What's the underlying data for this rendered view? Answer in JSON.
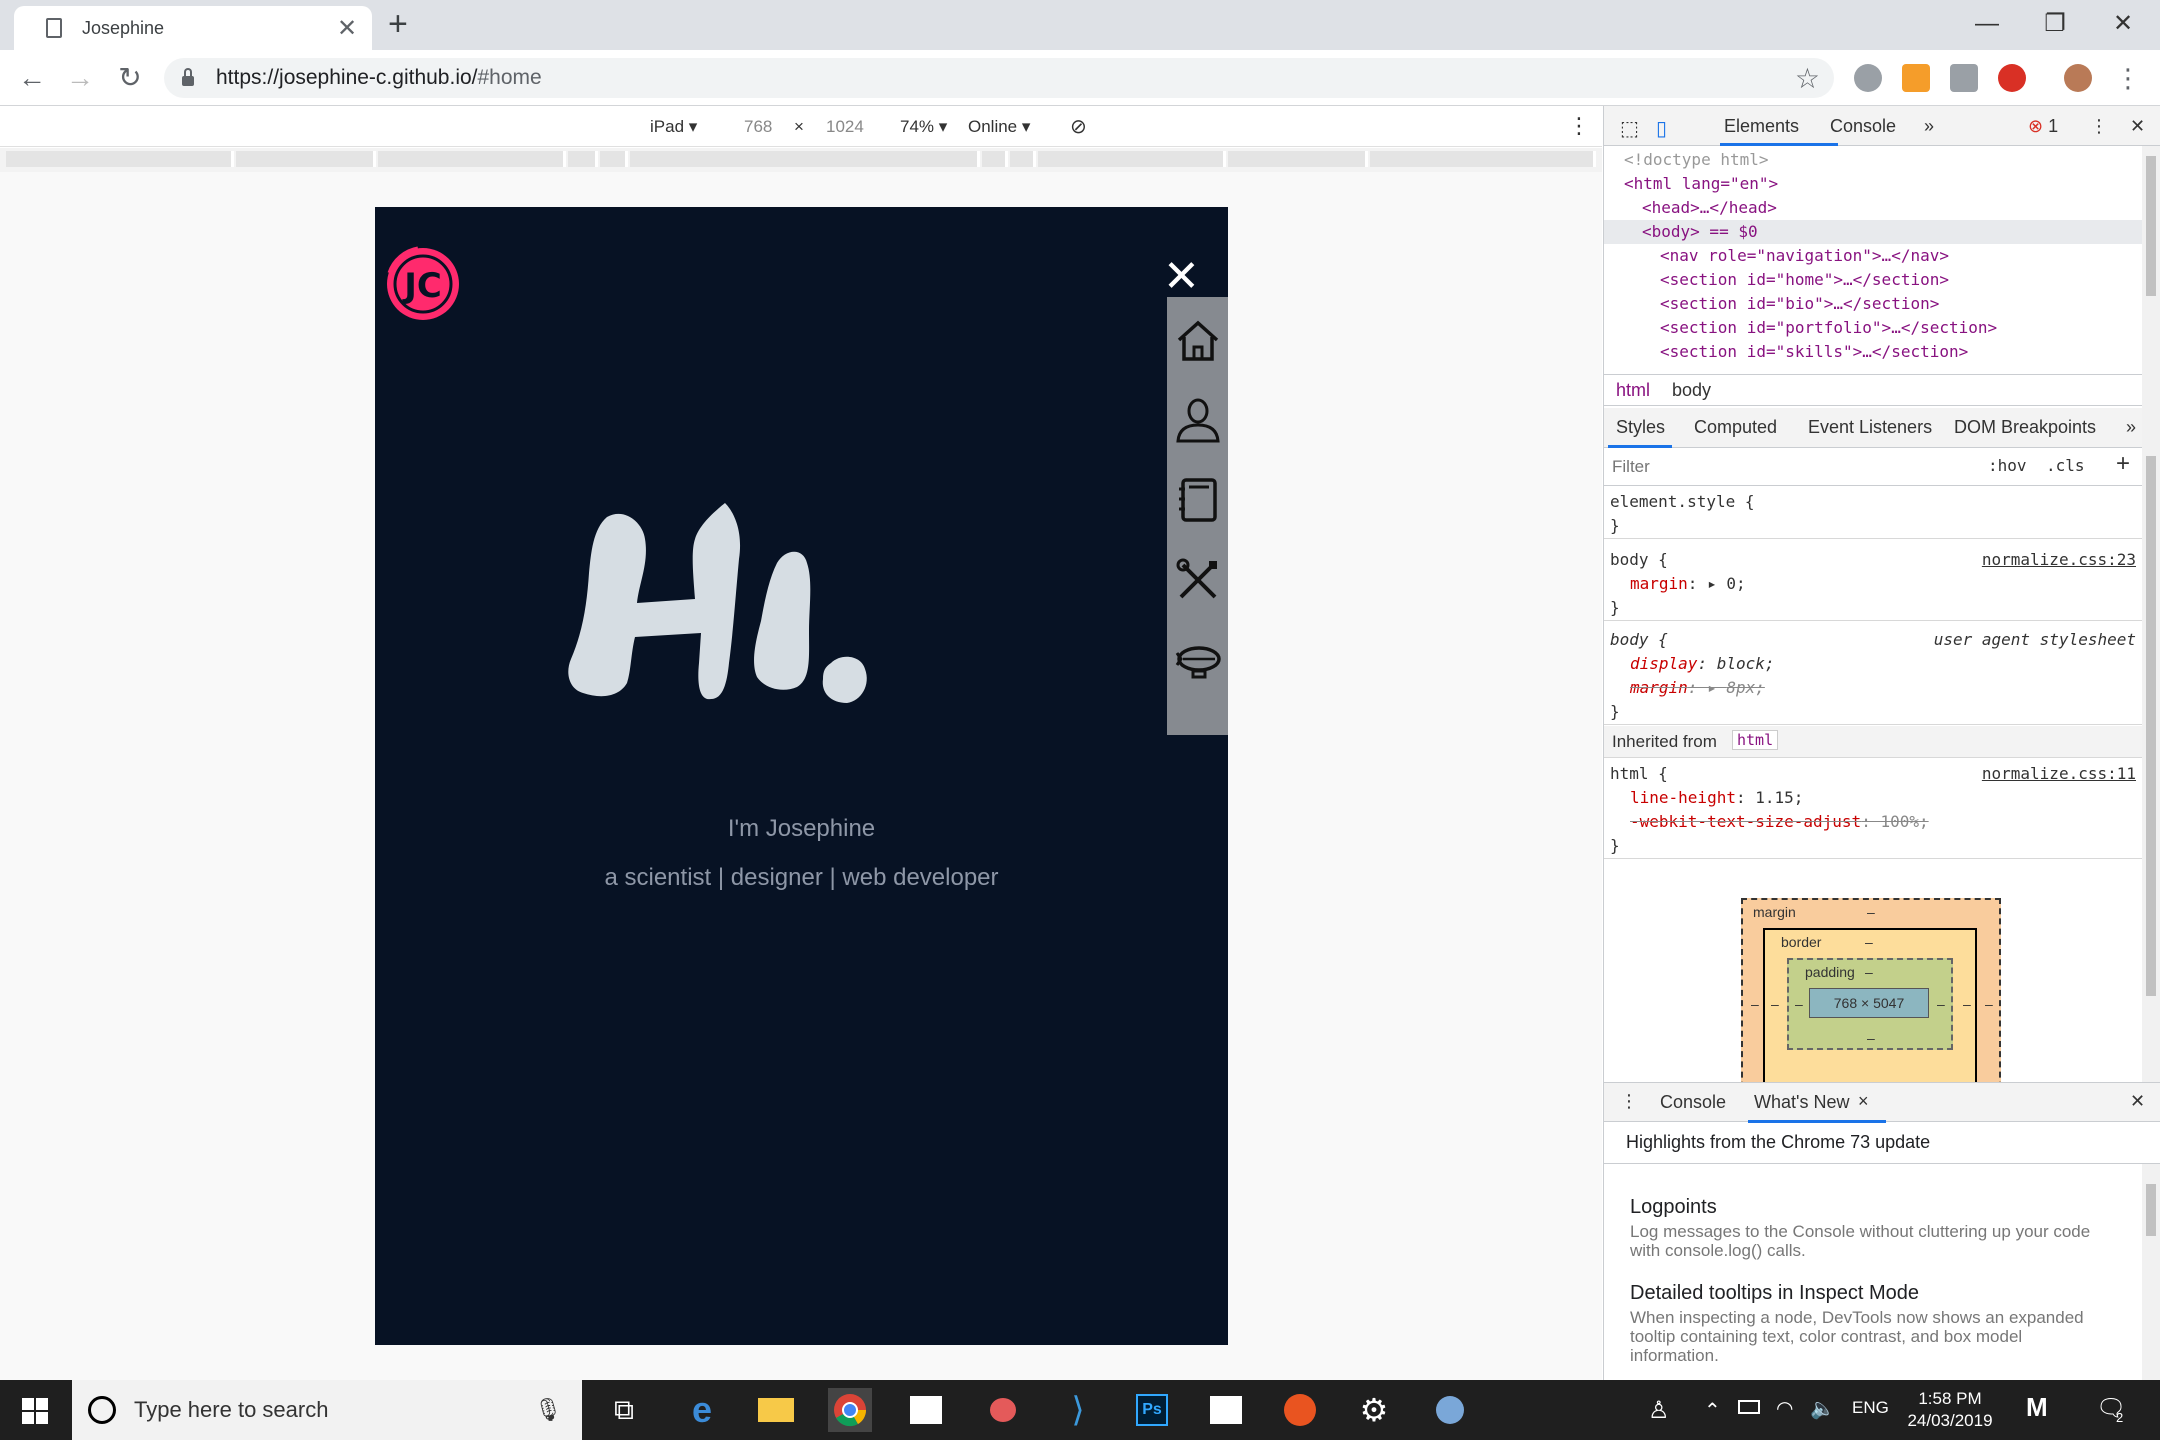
{
  "browser": {
    "tab_title": "Josephine",
    "tab_close": "✕",
    "new_tab": "+",
    "window_controls": {
      "minimize": "—",
      "restore": "❐",
      "close": "✕"
    },
    "url_host": "https://josephine-c.github.io/",
    "url_path": "#home"
  },
  "device_toolbar": {
    "device": "iPad",
    "width": "768",
    "times": "×",
    "height": "1024",
    "zoom": "74%",
    "network": "Online"
  },
  "page": {
    "logo_text": "JC",
    "intro_name": "I'm Josephine",
    "intro_roles": "a scientist | designer | web developer",
    "nav_icons": [
      "home-icon",
      "person-icon",
      "notebook-icon",
      "tools-icon",
      "blimp-icon"
    ],
    "colors": {
      "background": "#071224",
      "accent": "#ff2a6d",
      "hi_text": "#d6dde3",
      "sidenav": "#868a90"
    }
  },
  "devtools": {
    "tabs": {
      "elements": "Elements",
      "console": "Console",
      "more": "»"
    },
    "error_count": "1",
    "dom": [
      {
        "text": "<!doctype html>"
      },
      {
        "text": "<html lang=\"en\">"
      },
      {
        "text": "<head>…</head>"
      },
      {
        "text": "<body> == $0"
      },
      {
        "text": "<nav role=\"navigation\">…</nav>"
      },
      {
        "text": "<section id=\"home\">…</section>"
      },
      {
        "text": "<section id=\"bio\">…</section>"
      },
      {
        "text": "<section id=\"portfolio\">…</section>"
      },
      {
        "text": "<section id=\"skills\">…</section>"
      }
    ],
    "breadcrumbs": [
      "html",
      "body"
    ],
    "style_tabs": [
      "Styles",
      "Computed",
      "Event Listeners",
      "DOM Breakpoints",
      "»"
    ],
    "filter_placeholder": "Filter",
    "hov": ":hov",
    "cls": ".cls",
    "add": "+",
    "rules": {
      "element_style_open": "element.style {",
      "close": "}",
      "body1_selector": "body {",
      "body1_source": "normalize.css:23",
      "body1_prop": "margin",
      "body1_value": "0;",
      "body2_selector": "body {",
      "body2_source": "user agent stylesheet",
      "body2_prop1": "display",
      "body2_val1": "block;",
      "body2_prop2": "margin",
      "body2_val2": "8px;",
      "inherited_label": "Inherited from",
      "inherited_tag": "html",
      "html_selector": "html {",
      "html_source": "normalize.css:11",
      "html_prop1": "line-height",
      "html_val1": "1.15;",
      "html_prop2": "-webkit-text-size-adjust",
      "html_val2": "100%;"
    },
    "box_model": {
      "margin": "margin",
      "border": "border",
      "padding": "padding",
      "dash": "–",
      "content": "768 × 5047"
    },
    "drawer": {
      "console": "Console",
      "whats_new": "What's New",
      "tab_close": "×",
      "close": "✕",
      "highlight": "Highlights from the Chrome 73 update",
      "items": [
        {
          "title": "Logpoints",
          "body": "Log messages to the Console without cluttering up your code with console.log() calls."
        },
        {
          "title": "Detailed tooltips in Inspect Mode",
          "body": "When inspecting a node, DevTools now shows an expanded tooltip containing text, color contrast, and box model information."
        }
      ]
    }
  },
  "taskbar": {
    "search_placeholder": "Type here to search",
    "language": "ENG",
    "time": "1:58 PM",
    "date": "24/03/2019",
    "notification_count": "2"
  }
}
